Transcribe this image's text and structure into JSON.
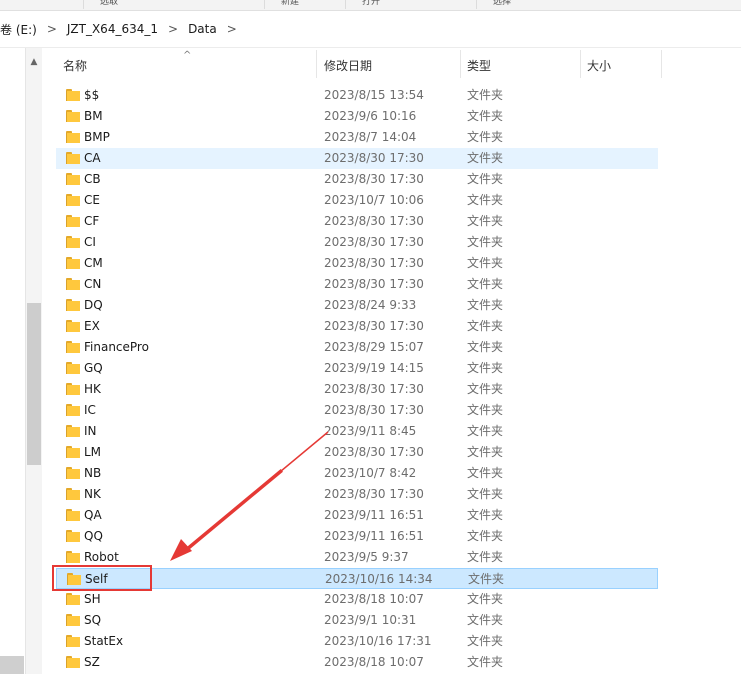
{
  "ribbon": {
    "labels": [
      "选取",
      "新建",
      "打开",
      "选择"
    ]
  },
  "address": {
    "crumbs": [
      "卷 (E:)",
      "JZT_X64_634_1",
      "Data"
    ],
    "separator": ">"
  },
  "columns": {
    "name": "名称",
    "date": "修改日期",
    "type": "类型",
    "size": "大小"
  },
  "sort_glyph": "^",
  "files": [
    {
      "name": "$$",
      "date": "2023/8/15 13:54",
      "type": "文件夹"
    },
    {
      "name": "BM",
      "date": "2023/9/6 10:16",
      "type": "文件夹"
    },
    {
      "name": "BMP",
      "date": "2023/8/7 14:04",
      "type": "文件夹"
    },
    {
      "name": "CA",
      "date": "2023/8/30 17:30",
      "type": "文件夹"
    },
    {
      "name": "CB",
      "date": "2023/8/30 17:30",
      "type": "文件夹"
    },
    {
      "name": "CE",
      "date": "2023/10/7 10:06",
      "type": "文件夹"
    },
    {
      "name": "CF",
      "date": "2023/8/30 17:30",
      "type": "文件夹"
    },
    {
      "name": "CI",
      "date": "2023/8/30 17:30",
      "type": "文件夹"
    },
    {
      "name": "CM",
      "date": "2023/8/30 17:30",
      "type": "文件夹"
    },
    {
      "name": "CN",
      "date": "2023/8/30 17:30",
      "type": "文件夹"
    },
    {
      "name": "DQ",
      "date": "2023/8/24 9:33",
      "type": "文件夹"
    },
    {
      "name": "EX",
      "date": "2023/8/30 17:30",
      "type": "文件夹"
    },
    {
      "name": "FinancePro",
      "date": "2023/8/29 15:07",
      "type": "文件夹"
    },
    {
      "name": "GQ",
      "date": "2023/9/19 14:15",
      "type": "文件夹"
    },
    {
      "name": "HK",
      "date": "2023/8/30 17:30",
      "type": "文件夹"
    },
    {
      "name": "IC",
      "date": "2023/8/30 17:30",
      "type": "文件夹"
    },
    {
      "name": "IN",
      "date": "2023/9/11 8:45",
      "type": "文件夹"
    },
    {
      "name": "LM",
      "date": "2023/8/30 17:30",
      "type": "文件夹"
    },
    {
      "name": "NB",
      "date": "2023/10/7 8:42",
      "type": "文件夹"
    },
    {
      "name": "NK",
      "date": "2023/8/30 17:30",
      "type": "文件夹"
    },
    {
      "name": "QA",
      "date": "2023/9/11 16:51",
      "type": "文件夹"
    },
    {
      "name": "QQ",
      "date": "2023/9/11 16:51",
      "type": "文件夹"
    },
    {
      "name": "Robot",
      "date": "2023/9/5 9:37",
      "type": "文件夹"
    },
    {
      "name": "Self",
      "date": "2023/10/16 14:34",
      "type": "文件夹"
    },
    {
      "name": "SH",
      "date": "2023/8/18 10:07",
      "type": "文件夹"
    },
    {
      "name": "SQ",
      "date": "2023/9/1 10:31",
      "type": "文件夹"
    },
    {
      "name": "StatEx",
      "date": "2023/10/16 17:31",
      "type": "文件夹"
    },
    {
      "name": "SZ",
      "date": "2023/8/18 10:07",
      "type": "文件夹"
    }
  ],
  "hover_index": 3,
  "selected_index": 23,
  "colors": {
    "hover_bg": "#e5f3ff",
    "selected_bg": "#cce8ff",
    "annotation": "#e53935",
    "folder": "#ffc83d"
  }
}
